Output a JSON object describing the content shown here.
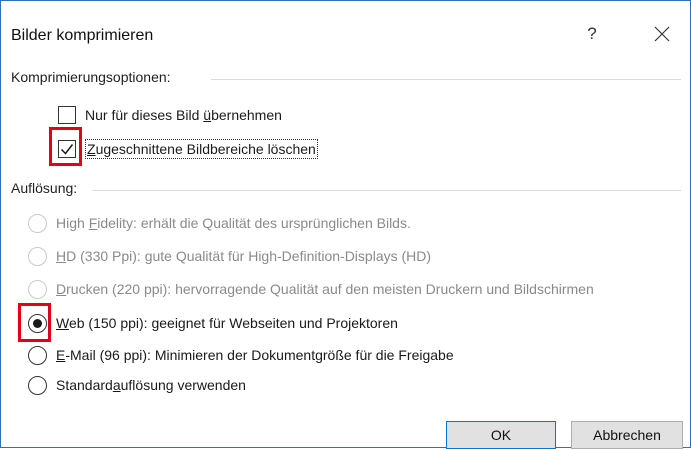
{
  "window": {
    "title": "Bilder komprimieren",
    "help_symbol": "?",
    "close_icon": "close-icon"
  },
  "compression": {
    "group_label": "Komprimierungsoptionen:",
    "options": [
      {
        "pre": "Nur für dieses Bild ",
        "accel": "ü",
        "post": "bernehmen",
        "checked": false,
        "highlighted": false
      },
      {
        "pre": "",
        "accel": "Z",
        "post": "ugeschnittene Bildbereiche löschen",
        "checked": true,
        "highlighted": true
      }
    ]
  },
  "resolution": {
    "group_label": "Auflösung:",
    "options": [
      {
        "pre": "High ",
        "accel": "F",
        "post": "idelity: erhält die Qualität des ursprünglichen Bilds.",
        "enabled": false,
        "selected": false,
        "highlighted": false
      },
      {
        "pre": "",
        "accel": "H",
        "post": "D (330 Ppi): gute Qualität für High-Definition-Displays (HD)",
        "enabled": false,
        "selected": false,
        "highlighted": false
      },
      {
        "pre": "",
        "accel": "D",
        "post": "rucken (220 ppi): hervorragende Qualität auf den meisten Druckern und Bildschirmen",
        "enabled": false,
        "selected": false,
        "highlighted": false
      },
      {
        "pre": "",
        "accel": "W",
        "post": "eb (150 ppi): geeignet für Webseiten und Projektoren",
        "enabled": true,
        "selected": true,
        "highlighted": true
      },
      {
        "pre": "",
        "accel": "E",
        "post": "-Mail (96 ppi): Minimieren der Dokumentgröße für die Freigabe",
        "enabled": true,
        "selected": false,
        "highlighted": false
      },
      {
        "pre": "Standard",
        "accel": "a",
        "post": "uflösung verwenden",
        "enabled": true,
        "selected": false,
        "highlighted": false
      }
    ]
  },
  "buttons": {
    "ok": "OK",
    "cancel": "Abbrechen"
  },
  "colors": {
    "highlight": "#e3001b",
    "dialog_border": "#2f6fb5",
    "primary_button_border": "#0078d7"
  }
}
